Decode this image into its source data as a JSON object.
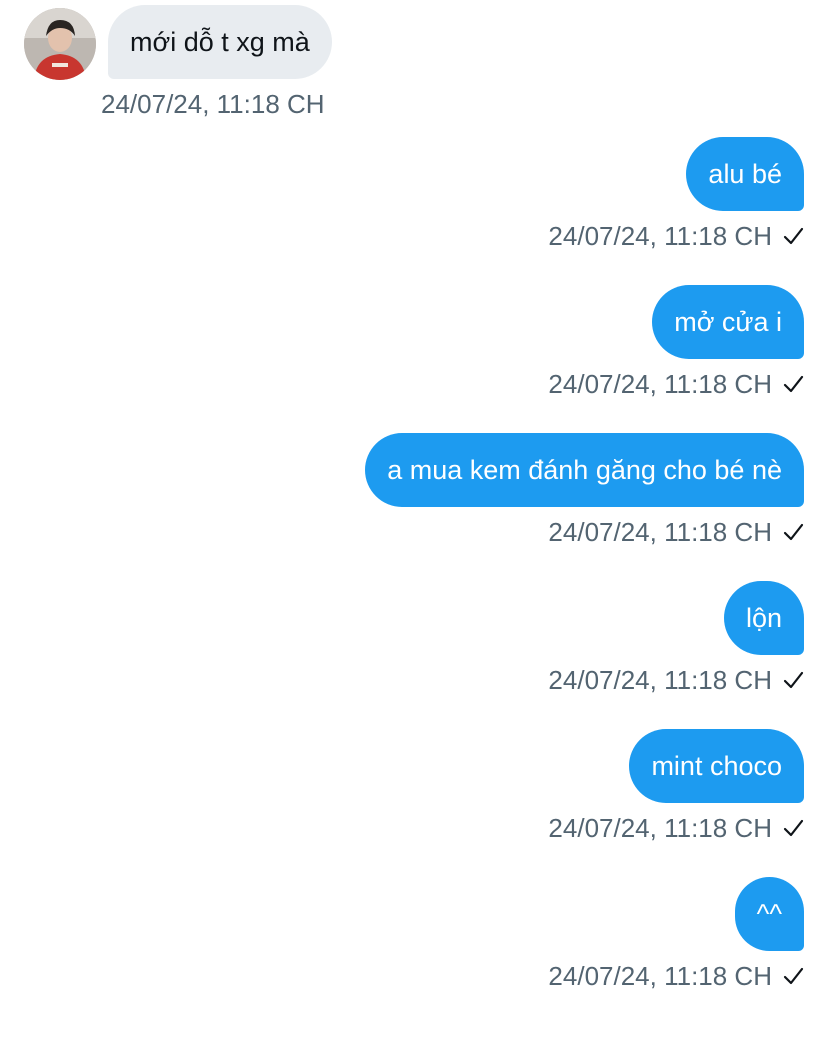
{
  "incoming": {
    "avatar_icon": "user-avatar-icon",
    "text": "mới dỗ t xg mà",
    "timestamp": "24/07/24, 11:18 CH",
    "bubble_color": "#e8ecf0"
  },
  "outgoing": [
    {
      "text": "alu bé",
      "timestamp": "24/07/24, 11:18 CH"
    },
    {
      "text": "mở cửa i",
      "timestamp": "24/07/24, 11:18 CH"
    },
    {
      "text": "a mua kem đánh găng cho bé nè",
      "timestamp": "24/07/24, 11:18 CH"
    },
    {
      "text": "lộn",
      "timestamp": "24/07/24, 11:18 CH"
    },
    {
      "text": "mint choco",
      "timestamp": "24/07/24, 11:18 CH"
    },
    {
      "text": "^^",
      "timestamp": "24/07/24, 11:18 CH"
    }
  ],
  "colors": {
    "accent": "#1d9bf0",
    "timestamp": "#536471",
    "check": "#0f1419"
  },
  "icons": {
    "sent_status": "check-icon"
  }
}
